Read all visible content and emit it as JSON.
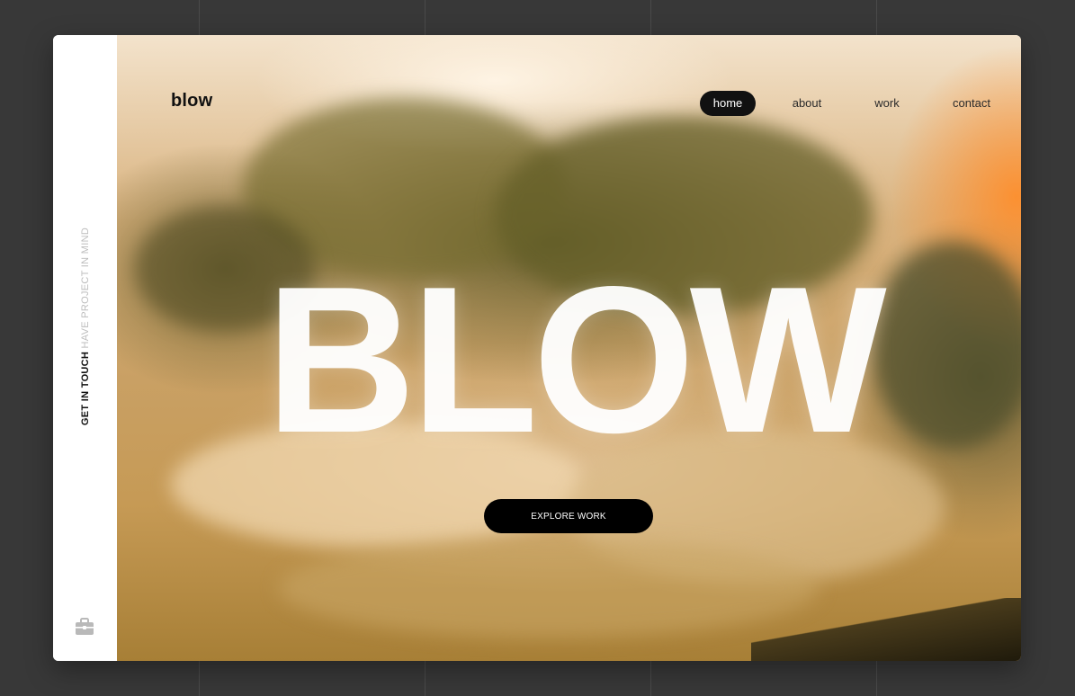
{
  "brand": {
    "logo": "blow"
  },
  "nav": {
    "items": [
      {
        "label": "home",
        "active": true
      },
      {
        "label": "about",
        "active": false
      },
      {
        "label": "work",
        "active": false
      },
      {
        "label": "contact",
        "active": false
      }
    ]
  },
  "sidebar": {
    "cta_primary": "GET IN TOUCH",
    "cta_secondary": "HAVE PROJECT IN MIND",
    "icon": "briefcase-icon"
  },
  "hero": {
    "headline": "BLOW",
    "button_label": "EXPLORE WORK"
  },
  "colors": {
    "accent": "#000000",
    "nav_active_bg": "#111111",
    "page_bg": "#383838",
    "hero_orange": "#ff8c28"
  }
}
